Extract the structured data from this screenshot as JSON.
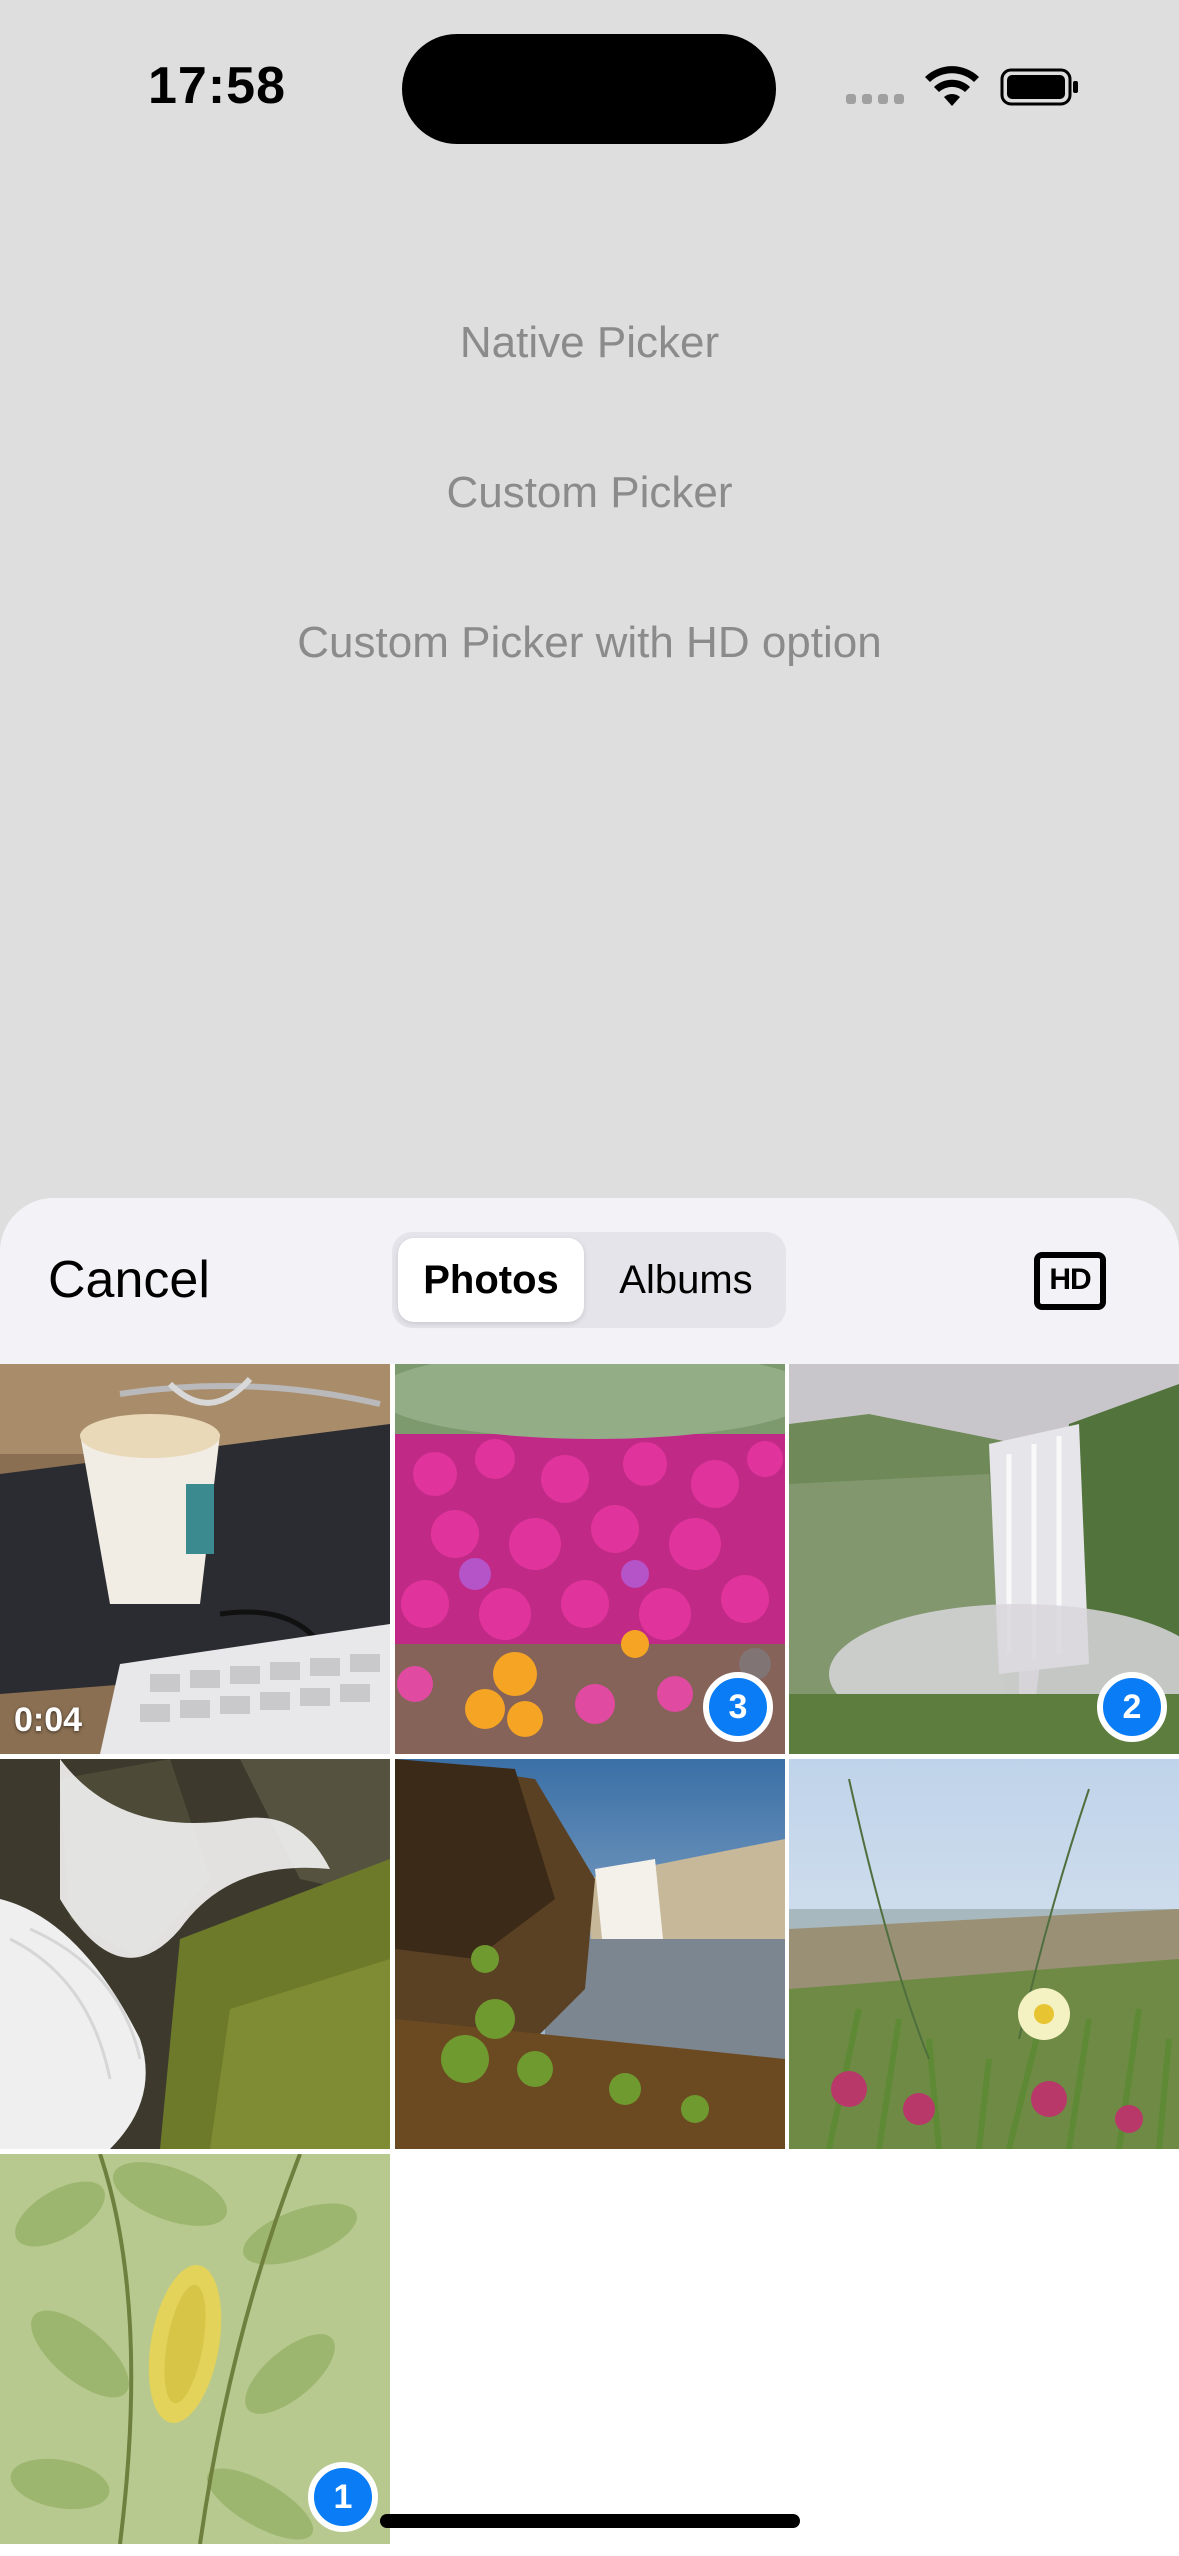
{
  "status_bar": {
    "time": "17:58",
    "icons": [
      "cellular-signal-icon",
      "wifi-icon",
      "battery-icon"
    ]
  },
  "menu": {
    "native_picker": "Native Picker",
    "custom_picker": "Custom Picker",
    "custom_picker_hd": "Custom Picker with HD option"
  },
  "sheet": {
    "cancel_label": "Cancel",
    "tabs": [
      {
        "label": "Photos",
        "selected": true
      },
      {
        "label": "Albums",
        "selected": false
      }
    ],
    "hd_label": "HD",
    "accent_color": "#0a7cf5"
  },
  "grid": {
    "items": [
      {
        "kind": "video",
        "subject": "coffee cup and keyboard",
        "duration": "0:04",
        "selection": null
      },
      {
        "kind": "photo",
        "subject": "pink flowers",
        "selection": "3"
      },
      {
        "kind": "photo",
        "subject": "waterfall in mist",
        "selection": "2"
      },
      {
        "kind": "photo",
        "subject": "waterfall over mossy rocks",
        "selection": null
      },
      {
        "kind": "photo",
        "subject": "waterfall at sunset",
        "selection": null
      },
      {
        "kind": "photo",
        "subject": "beach flowers",
        "selection": null
      },
      {
        "kind": "photo",
        "subject": "green leaves",
        "selection": "1"
      }
    ]
  }
}
